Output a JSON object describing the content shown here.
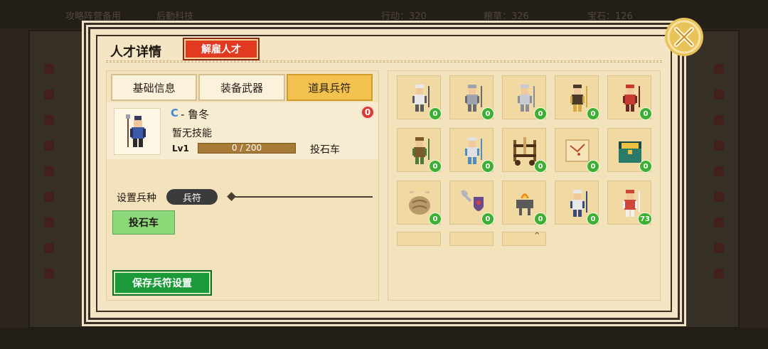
{
  "background": {
    "topbar": [
      "攻略阵营备用",
      "后勤科技",
      "行动：320",
      "粮草：326",
      "宝石：126"
    ]
  },
  "dialog": {
    "title": "人才详情",
    "fire_button": "解雇人才",
    "tabs": [
      {
        "label": "基础信息",
        "active": false
      },
      {
        "label": "装备武器",
        "active": false
      },
      {
        "label": "道具兵符",
        "active": true
      }
    ],
    "hero": {
      "grade": "C",
      "name": "- 鲁冬",
      "skill": "暂无技能",
      "level": "Lv1",
      "xp_text": "0 / 200",
      "xp_fraction": 0.0,
      "troop_type": "投石车",
      "red_badge": "0"
    },
    "set_troop_label": "设置兵种",
    "token_pill": "兵符",
    "selected_troop": "投石车",
    "save_button": "保存兵符设置"
  },
  "inventory": {
    "items": [
      {
        "icon": "swordsman-icon",
        "count": "0"
      },
      {
        "icon": "helmet-soldier-icon",
        "count": "0"
      },
      {
        "icon": "knight-icon",
        "count": "0"
      },
      {
        "icon": "bearded-warrior-icon",
        "count": "0"
      },
      {
        "icon": "red-turban-warrior-icon",
        "count": "0"
      },
      {
        "icon": "shield-bearer-icon",
        "count": "0"
      },
      {
        "icon": "spearman-icon",
        "count": "0"
      },
      {
        "icon": "siege-engine-icon",
        "count": "0"
      },
      {
        "icon": "scroll-map-icon",
        "count": "0"
      },
      {
        "icon": "treasure-chest-icon",
        "count": "0"
      },
      {
        "icon": "stone-brain-icon",
        "count": "0"
      },
      {
        "icon": "axe-shield-icon",
        "count": "0"
      },
      {
        "icon": "brazier-icon",
        "count": "0"
      },
      {
        "icon": "scholar-icon",
        "count": "0"
      },
      {
        "icon": "elder-official-icon",
        "count": "73"
      }
    ]
  },
  "colors": {
    "fire_red": "#e23a21",
    "save_green": "#1c9a39",
    "active_tab": "#f2c14e",
    "grade_blue": "#3c8fd6",
    "count_green": "#3fae34"
  }
}
